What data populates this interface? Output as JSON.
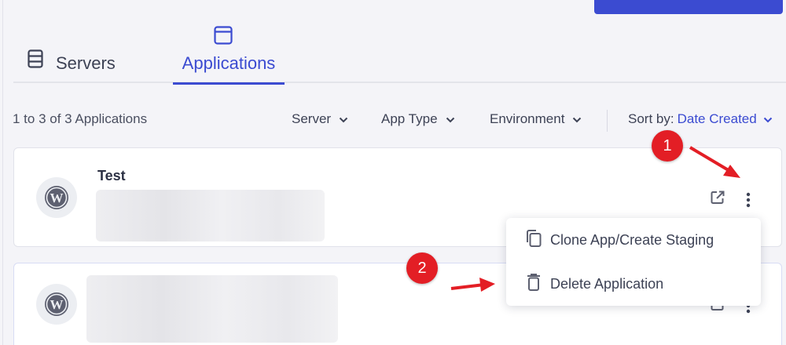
{
  "tabs": [
    {
      "label": "Servers",
      "icon": "server-icon",
      "active": false
    },
    {
      "label": "Applications",
      "icon": "window-icon",
      "active": true
    }
  ],
  "filters": {
    "count_text": "1 to 3 of 3 Applications",
    "server_label": "Server",
    "apptype_label": "App Type",
    "environment_label": "Environment",
    "sort_label": "Sort by:",
    "sort_value": "Date Created"
  },
  "apps": [
    {
      "name": "Test",
      "icon": "wordpress-icon"
    },
    {
      "name": "",
      "icon": "wordpress-icon"
    }
  ],
  "context_menu": {
    "clone_label": "Clone App/Create Staging",
    "delete_label": "Delete Application"
  },
  "annotations": {
    "badge1": "1",
    "badge2": "2"
  },
  "colors": {
    "accent": "#3b4bd1",
    "annotation_red": "#e31e25"
  }
}
